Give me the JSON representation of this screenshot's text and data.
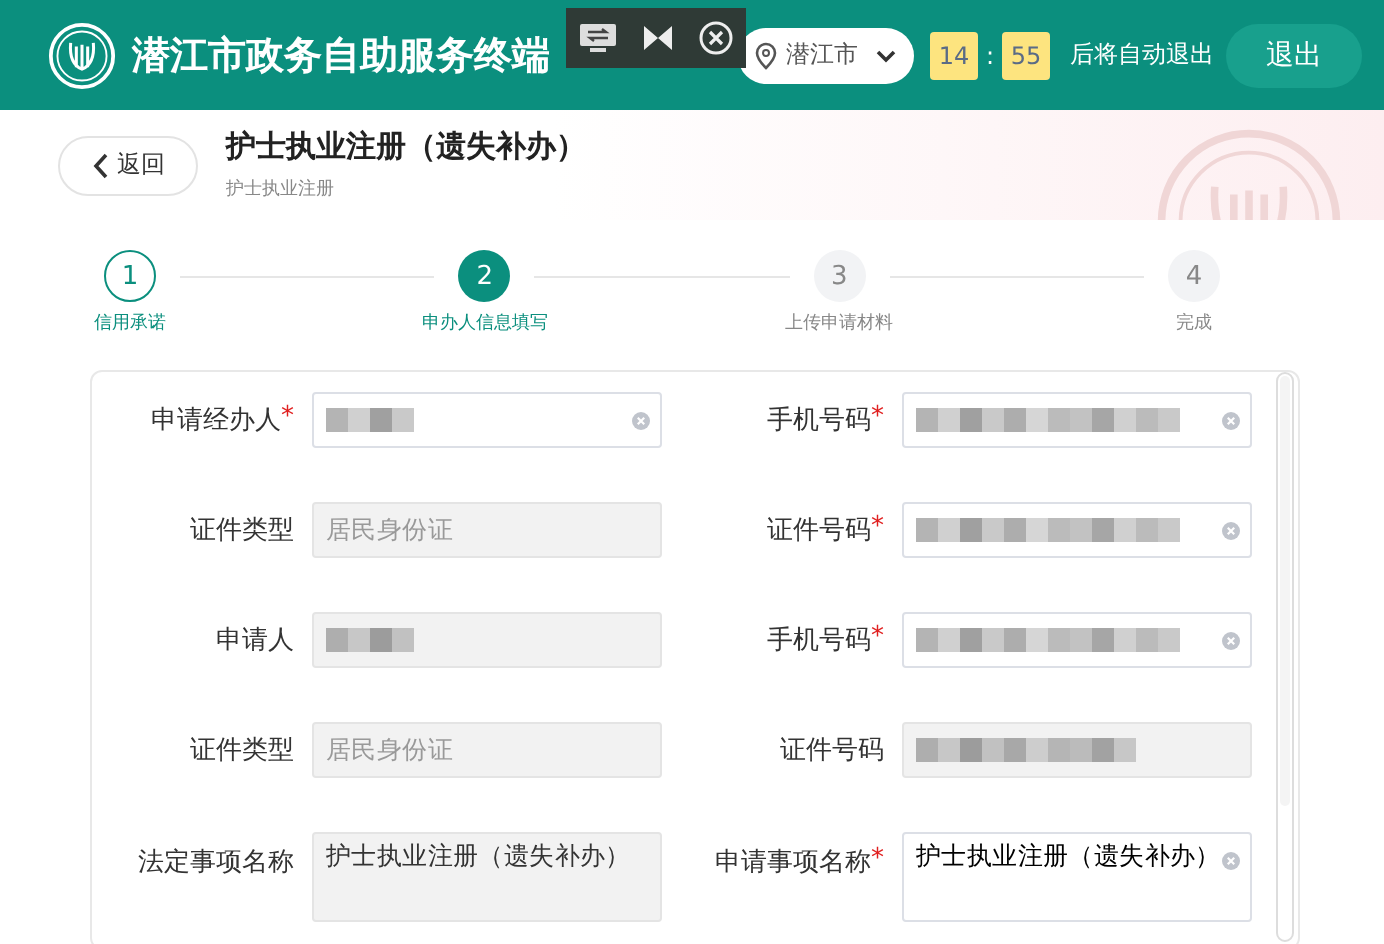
{
  "header": {
    "title": "潜江市政务自助服务终端",
    "location": "潜江市",
    "countdown": {
      "minutes": "14",
      "separator": ":",
      "seconds": "55",
      "suffix": "后将自动退出"
    },
    "exit_button": "退出"
  },
  "page": {
    "back_button": "返回",
    "title": "护士执业注册（遗失补办）",
    "subtitle": "护士执业注册"
  },
  "steps": [
    {
      "number": "1",
      "label": "信用承诺",
      "completed": true,
      "selected": false
    },
    {
      "number": "2",
      "label": "申办人信息填写",
      "completed": false,
      "selected": true
    },
    {
      "number": "3",
      "label": "上传申请材料",
      "completed": false,
      "selected": false
    },
    {
      "number": "4",
      "label": "完成",
      "completed": false,
      "selected": false
    }
  ],
  "form": {
    "rows": [
      [
        {
          "label": "申请经办人",
          "required_mark": "*",
          "kind": "input",
          "blurred": true,
          "clearable": true
        },
        {
          "label": "手机号码",
          "required_mark": "*",
          "kind": "input",
          "blurred": true,
          "clearable": true
        }
      ],
      [
        {
          "label": "证件类型",
          "kind": "readonly",
          "value": "居民身份证"
        },
        {
          "label": "证件号码",
          "required_mark": "*",
          "kind": "input",
          "blurred": true,
          "clearable": true
        }
      ],
      [
        {
          "label": "申请人",
          "kind": "readonly",
          "blurred": true
        },
        {
          "label": "手机号码",
          "required_mark": "*",
          "kind": "input",
          "blurred": true,
          "clearable": true
        }
      ],
      [
        {
          "label": "证件类型",
          "kind": "readonly",
          "value": "居民身份证"
        },
        {
          "label": "证件号码",
          "kind": "readonly",
          "blurred": true
        }
      ],
      [
        {
          "label": "法定事项名称",
          "kind": "textarea-readonly",
          "value": "护士执业注册（遗失补办）"
        },
        {
          "label": "申请事项名称",
          "required_mark": "*",
          "kind": "textarea",
          "value": "护士执业注册（遗失补办）",
          "clearable": true
        }
      ]
    ]
  }
}
